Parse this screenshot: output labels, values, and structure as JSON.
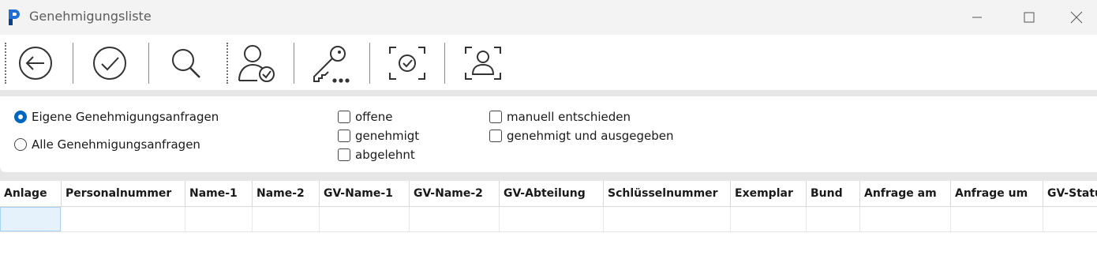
{
  "window": {
    "title": "Genehmigungsliste",
    "icon": "app-logo-icon",
    "controls": [
      "minimize-icon",
      "maximize-icon",
      "close-icon"
    ]
  },
  "toolbar": {
    "buttons": [
      {
        "name": "back-button",
        "icon": "arrow-left-circle-icon"
      },
      {
        "name": "approve-button",
        "icon": "checkmark-circle-icon"
      },
      {
        "name": "search-button",
        "icon": "magnifier-icon"
      },
      {
        "name": "person-approve-button",
        "icon": "person-check-icon"
      },
      {
        "name": "keys-button",
        "icon": "key-more-icon"
      },
      {
        "name": "scan-approve-button",
        "icon": "scan-check-icon"
      },
      {
        "name": "scan-person-button",
        "icon": "scan-person-icon"
      }
    ]
  },
  "filters": {
    "scope": {
      "selected": "Eigene Genehmigungsanfragen",
      "options": [
        "Eigene Genehmigungsanfragen",
        "Alle Genehmigungsanfragen"
      ]
    },
    "status_checks": [
      {
        "label": "offene",
        "checked": false
      },
      {
        "label": "genehmigt",
        "checked": false
      },
      {
        "label": "abgelehnt",
        "checked": false
      },
      {
        "label": "manuell entschieden",
        "checked": false
      },
      {
        "label": "genehmigt und ausgegeben",
        "checked": false
      }
    ]
  },
  "table": {
    "columns": [
      "Anlage",
      "Personalnummer",
      "Name-1",
      "Name-2",
      "GV-Name-1",
      "GV-Name-2",
      "GV-Abteilung",
      "Schlüsselnummer",
      "Exemplar",
      "Bund",
      "Anfrage am",
      "Anfrage um",
      "GV-Status"
    ],
    "rows": []
  },
  "colors": {
    "accent": "#0067c0",
    "selection": "#e5f1fb",
    "band": "#e6e6e6"
  }
}
